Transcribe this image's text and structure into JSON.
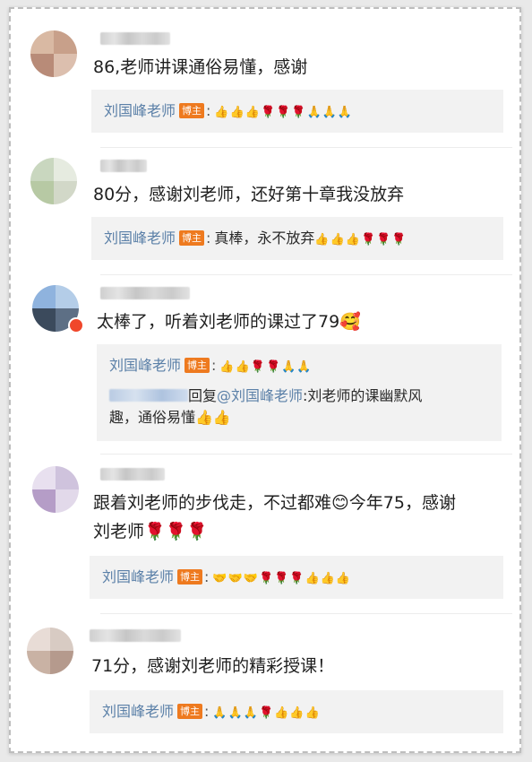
{
  "author": {
    "name": "刘国峰老师",
    "badge": "博主",
    "colon": ":"
  },
  "comments": [
    {
      "text": "86,老师讲课通俗易懂，感谢",
      "reply_text": "",
      "reply_emoji": "👍👍👍🌹🌹🌹🙏🙏🙏"
    },
    {
      "text": "80分，感谢刘老师，还好第十章我没放弃",
      "reply_text": "真棒，永不放弃",
      "reply_emoji": "👍👍👍🌹🌹🌹"
    },
    {
      "text": "太棒了，听着刘老师的课过了79🥰",
      "reply_text": "",
      "reply_emoji": "👍👍🌹🌹🙏🙏",
      "sub_reply": {
        "prefix": "回复",
        "mention": "@刘国峰老师",
        "text_line1": ":刘老师的课幽默风",
        "text_line2": "趣，通俗易懂👍👍"
      }
    },
    {
      "text_line1": "跟着刘老师的步伐走，不过都难😊今年75，感谢",
      "text_line2": "刘老师🌹🌹🌹",
      "reply_text": "",
      "reply_emoji": "🤝🤝🤝🌹🌹🌹👍👍👍"
    },
    {
      "text": "71分，感谢刘老师的精彩授课！",
      "reply_text": "",
      "reply_emoji": "🙏🙏🙏🌹👍👍👍"
    }
  ],
  "colors": {
    "author_link": "#5b80a8",
    "badge": "#ee7a1f",
    "reply_bg": "#f2f2f2"
  }
}
